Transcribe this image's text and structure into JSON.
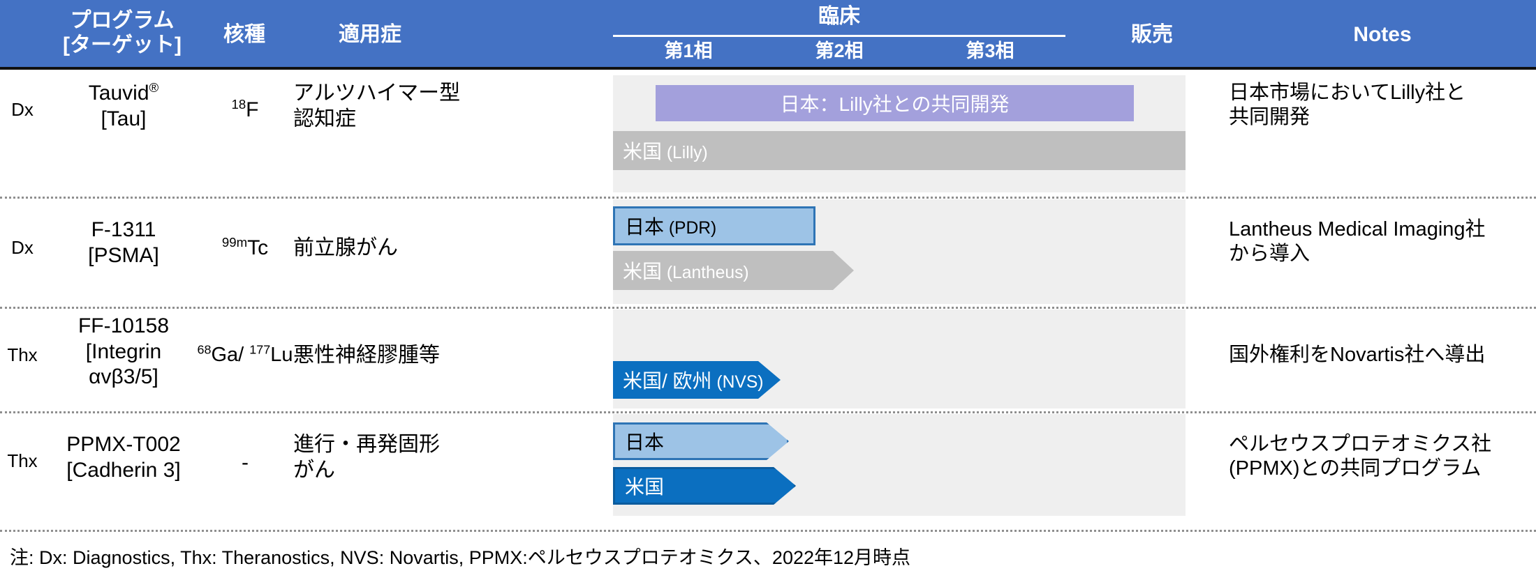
{
  "header": {
    "col_type": "",
    "col_program_line1": "プログラム",
    "col_program_line2": "[ターゲット]",
    "col_nuclide": "核種",
    "col_indication": "適用症",
    "col_clinical": "臨床",
    "phase1": "第1相",
    "phase2": "第2相",
    "phase3": "第3相",
    "col_sales": "販売",
    "col_notes": "Notes"
  },
  "rows": [
    {
      "type": "Dx",
      "program_line1": "Tauvid",
      "program_sup": "®",
      "program_line2": "[Tau]",
      "nuclide_sup": "18",
      "nuclide_main": "F",
      "indication_line1": "アルツハイマー型",
      "indication_line2": "認知症",
      "notes_line1": "日本市場においてLilly社と",
      "notes_line2": "共同開発",
      "bars": [
        {
          "label": "日本：Lilly社との共同開発",
          "sub": "",
          "style": "bar-purple",
          "align": "center"
        },
        {
          "label": "米国",
          "sub": " (Lilly)",
          "style": "bar-gray",
          "align": "left"
        }
      ]
    },
    {
      "type": "Dx",
      "program_line1": "F-1311",
      "program_sup": "",
      "program_line2": "[PSMA]",
      "nuclide_sup": "99m",
      "nuclide_main": "Tc",
      "indication_line1": "前立腺がん",
      "indication_line2": "",
      "notes_line1": "Lantheus Medical Imaging社",
      "notes_line2": "から導入",
      "bars": [
        {
          "label": "日本",
          "sub": " (PDR)",
          "style": "bar-ltblue",
          "align": "left"
        },
        {
          "label": "米国",
          "sub": " (Lantheus)",
          "style": "arrow-gray",
          "align": "left"
        }
      ]
    },
    {
      "type": "Thx",
      "program_line1": "FF-10158",
      "program_sup": "",
      "program_line2": "[Integrin",
      "program_line3": "αvβ3/5]",
      "nuclide_sup": "68",
      "nuclide_main": "Ga/ ",
      "nuclide_sup2": "177",
      "nuclide_main2": "Lu",
      "indication_line1": "悪性神経膠腫等",
      "indication_line2": "",
      "notes_line1": "国外権利をNovartis社へ導出",
      "notes_line2": "",
      "bars": [
        {
          "label": "米国/ 欧州",
          "sub": " (NVS)",
          "style": "arrow-blue",
          "align": "left"
        }
      ]
    },
    {
      "type": "Thx",
      "program_line1": "PPMX-T002",
      "program_sup": "",
      "program_line2": "[Cadherin 3]",
      "nuclide_sup": "",
      "nuclide_main": "-",
      "indication_line1": "進行・再発固形",
      "indication_line2": "がん",
      "notes_line1": "ペルセウスプロテオミクス社",
      "notes_line2": "(PPMX)との共同プログラム",
      "bars": [
        {
          "label": "日本",
          "sub": "",
          "style": "arrow-ltblue",
          "align": "left"
        },
        {
          "label": "米国",
          "sub": "",
          "style": "arrow-blue-out",
          "align": "left"
        }
      ]
    }
  ],
  "footnote": "注: Dx: Diagnostics, Thx: Theranostics, NVS: Novartis, PPMX:ペルセウスプロテオミクス、2022年12月時点",
  "colors": {
    "header_blue": "#4472C4",
    "panel_gray": "#efefef",
    "bar_purple": "#A3A0DC",
    "bar_gray": "#BFBFBF",
    "bar_light_blue": "#9DC3E6",
    "bar_blue": "#0B6FC0",
    "bar_border_blue": "#2E74B5"
  }
}
